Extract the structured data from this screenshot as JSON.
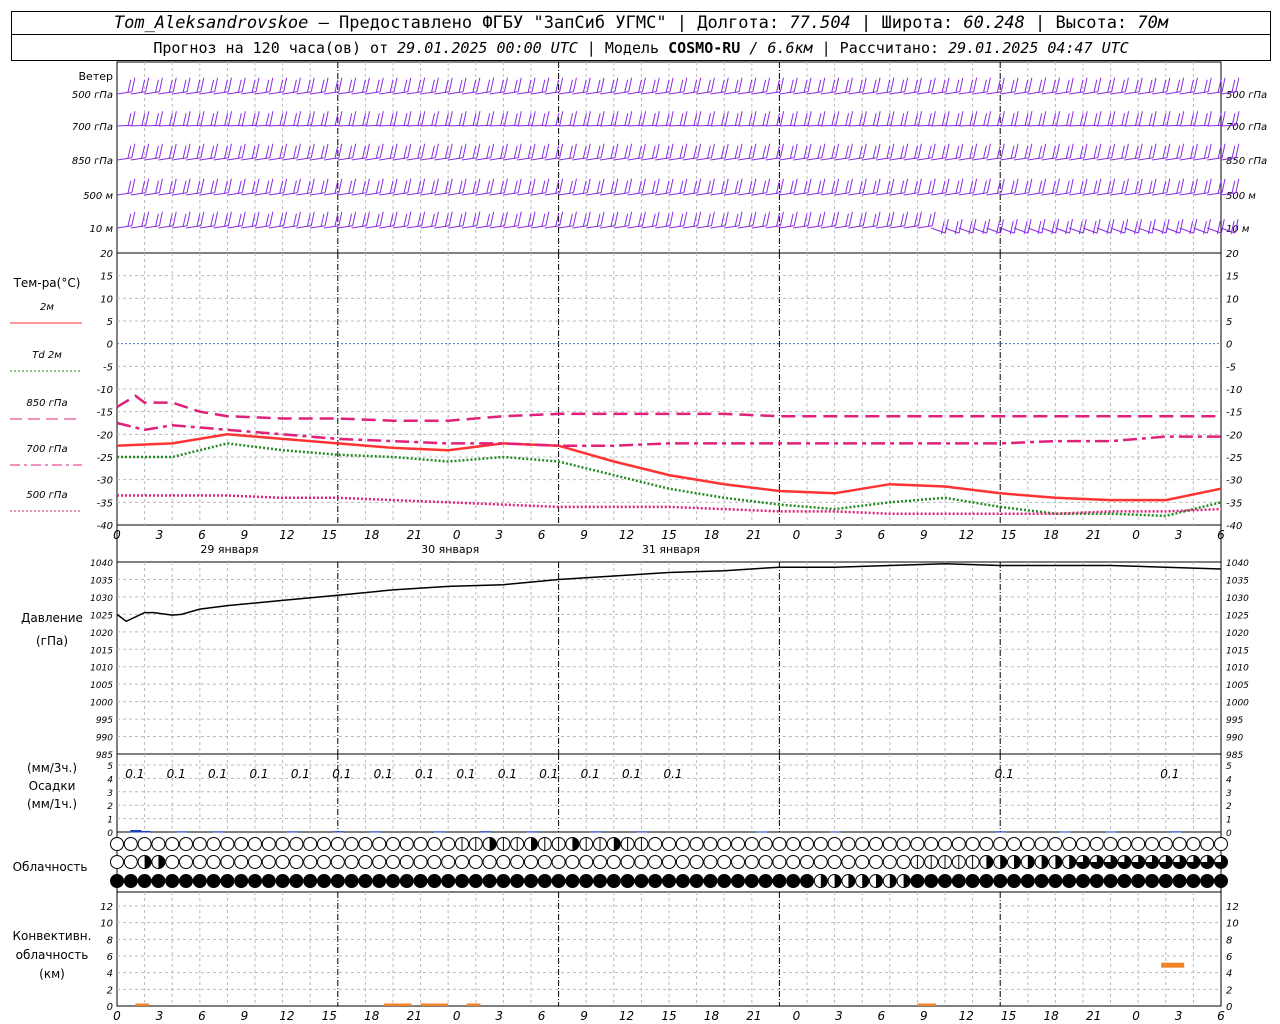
{
  "header": {
    "station": "Tom_Aleksandrovskoe",
    "provider": " — Предоставлено ФГБУ \"ЗапСиб УГМС\" | Долгота: ",
    "lon": "77.504",
    "lat_label": " | Широта: ",
    "lat": "60.248",
    "alt_label": " | Высота: ",
    "alt": "70м",
    "forecast_label": "Прогноз на 120 часа(ов) от ",
    "init_time": "29.01.2025 00:00 UTC",
    "model_label": "  | Модель ",
    "model": "COSMO-RU",
    "resolution": " / 6.6км",
    "calc_label": " | Рассчитано: ",
    "calc_time": "29.01.2025 04:47 UTC"
  },
  "chart_data": {
    "type": "meteogram",
    "hour_ticks": [
      "0",
      "3",
      "6",
      "9",
      "12",
      "15",
      "18",
      "21",
      "0",
      "3",
      "6",
      "9",
      "12",
      "15",
      "18",
      "21",
      "0",
      "3",
      "6",
      "9",
      "12",
      "15",
      "18",
      "21",
      "0",
      "3",
      "6"
    ],
    "dates": [
      "29 января",
      "30 января",
      "31 января"
    ],
    "wind": {
      "title": "Ветер",
      "levels": [
        "500 гПа",
        "700 гПа",
        "850 гПа",
        "500 м",
        "10 м"
      ],
      "color": "#8a2be2"
    },
    "temperature": {
      "title": "Тем-ра(°C)",
      "ylim": [
        -40,
        20
      ],
      "ticks": [
        20,
        15,
        10,
        5,
        0,
        -5,
        -10,
        -15,
        -20,
        -25,
        -30,
        -35,
        -40
      ],
      "legend": [
        {
          "label": "2м",
          "color": "#ff3333",
          "dash": "solid"
        },
        {
          "label": "Td  2м",
          "color": "#228b22",
          "dash": "dot"
        },
        {
          "label": "850 гПа",
          "color": "#e0207a",
          "dash": "long"
        },
        {
          "label": "700 гПа",
          "color": "#e0207a",
          "dash": "dashdot"
        },
        {
          "label": "500 гПа",
          "color": "#e0207a",
          "dash": "dot"
        }
      ],
      "series": [
        {
          "name": "2м",
          "hours": [
            0,
            6,
            12,
            18,
            24,
            30,
            36,
            42,
            48,
            54,
            60,
            66,
            72,
            78,
            84,
            90,
            96,
            102,
            108,
            114,
            120
          ],
          "values": [
            -22.5,
            -22,
            -20,
            -21,
            -22,
            -23,
            -23.5,
            -22,
            -22.5,
            -26,
            -29,
            -31,
            -32.5,
            -33,
            -31,
            -31.5,
            -33,
            -34,
            -34.5,
            -34.5,
            -32
          ]
        },
        {
          "name": "Td  2м",
          "hours": [
            0,
            6,
            12,
            18,
            24,
            30,
            36,
            42,
            48,
            54,
            60,
            66,
            72,
            78,
            84,
            90,
            96,
            102,
            108,
            114,
            120
          ],
          "values": [
            -25,
            -25,
            -22,
            -23.5,
            -24.5,
            -25,
            -26,
            -25,
            -26,
            -29,
            -32,
            -34,
            -35.5,
            -36.5,
            -35,
            -34,
            -36,
            -37.5,
            -37.5,
            -38,
            -35
          ]
        },
        {
          "name": "850 гПа",
          "hours": [
            0,
            2,
            3,
            6,
            9,
            12,
            18,
            24,
            30,
            36,
            42,
            48,
            54,
            60,
            66,
            72,
            78,
            84,
            90,
            96,
            102,
            108,
            114,
            120
          ],
          "values": [
            -14,
            -11.5,
            -13,
            -13,
            -15,
            -16,
            -16.5,
            -16.5,
            -17,
            -17,
            -16,
            -15.5,
            -15.5,
            -15.5,
            -15.5,
            -16,
            -16,
            -16,
            -16,
            -16,
            -16,
            -16,
            -16,
            -16
          ]
        },
        {
          "name": "700 гПа",
          "hours": [
            0,
            3,
            6,
            12,
            18,
            24,
            30,
            36,
            42,
            48,
            54,
            60,
            66,
            72,
            78,
            84,
            90,
            96,
            102,
            108,
            114,
            120
          ],
          "values": [
            -17.5,
            -19,
            -18,
            -19,
            -20,
            -21,
            -21.5,
            -22,
            -22,
            -22.5,
            -22.5,
            -22,
            -22,
            -22,
            -22,
            -22,
            -22,
            -22,
            -21.5,
            -21.5,
            -20.5,
            -20.5
          ]
        },
        {
          "name": "500 гПа",
          "hours": [
            0,
            6,
            12,
            18,
            24,
            30,
            36,
            42,
            48,
            54,
            60,
            66,
            72,
            78,
            84,
            90,
            96,
            102,
            108,
            114,
            120
          ],
          "values": [
            -33.5,
            -33.5,
            -33.5,
            -34,
            -34,
            -34.5,
            -35,
            -35.5,
            -36,
            -36,
            -36,
            -36.5,
            -37,
            -37,
            -37.5,
            -37.5,
            -37.5,
            -37.5,
            -37,
            -37,
            -36.5
          ]
        }
      ]
    },
    "pressure": {
      "title": "Давление",
      "unit": "(гПа)",
      "ylim": [
        985,
        1040
      ],
      "ticks": [
        1040,
        1035,
        1030,
        1025,
        1020,
        1015,
        1010,
        1005,
        1000,
        995,
        990,
        985
      ],
      "hours": [
        0,
        1,
        3,
        4,
        6,
        7,
        9,
        12,
        18,
        24,
        30,
        36,
        42,
        48,
        54,
        60,
        66,
        72,
        78,
        84,
        90,
        96,
        102,
        108,
        114,
        120
      ],
      "values": [
        1025,
        1023,
        1025.5,
        1025.5,
        1024.8,
        1025,
        1026.5,
        1027.5,
        1029,
        1030.5,
        1032,
        1033,
        1033.5,
        1035,
        1036,
        1037,
        1037.5,
        1038.5,
        1038.5,
        1039,
        1039.5,
        1039,
        1039,
        1039,
        1038.5,
        1038
      ]
    },
    "precip": {
      "title1": "(мм/3ч.)",
      "title2": "Осадки",
      "title3": "(мм/1ч.)",
      "ylim": [
        0,
        5
      ],
      "ticks": [
        5,
        4,
        3,
        2,
        1,
        0
      ],
      "labels_3h": [
        {
          "hour": 1.5,
          "value": "0.1"
        },
        {
          "hour": 6,
          "value": "0.1"
        },
        {
          "hour": 10.5,
          "value": "0.1"
        },
        {
          "hour": 15,
          "value": "0.1"
        },
        {
          "hour": 19.5,
          "value": "0.1"
        },
        {
          "hour": 24,
          "value": "0.1"
        },
        {
          "hour": 28.5,
          "value": "0.1"
        },
        {
          "hour": 33,
          "value": "0.1"
        },
        {
          "hour": 37.5,
          "value": "0.1"
        },
        {
          "hour": 42,
          "value": "0.1"
        },
        {
          "hour": 46.5,
          "value": "0.1"
        },
        {
          "hour": 51,
          "value": "0.1"
        },
        {
          "hour": 55.5,
          "value": "0.1"
        },
        {
          "hour": 60,
          "value": "0.1"
        },
        {
          "hour": 96,
          "value": "0.1"
        },
        {
          "hour": 114,
          "value": "0.1"
        }
      ],
      "bars_1h": [
        [
          2,
          0.15
        ],
        [
          3,
          0.08
        ],
        [
          7,
          0.05
        ],
        [
          11,
          0.05
        ],
        [
          19,
          0.05
        ],
        [
          24,
          0.06
        ],
        [
          28,
          0.05
        ],
        [
          35,
          0.05
        ],
        [
          40,
          0.06
        ],
        [
          45,
          0.05
        ],
        [
          52,
          0.05
        ],
        [
          57,
          0.05
        ],
        [
          70,
          0.04
        ],
        [
          78,
          0.04
        ],
        [
          96,
          0.05
        ],
        [
          103,
          0.04
        ],
        [
          108,
          0.04
        ],
        [
          115,
          0.05
        ]
      ]
    },
    "cloudiness": {
      "title": "Облачность",
      "rows": [
        {
          "name": "high",
          "cover": [
            0,
            0,
            0,
            0,
            0,
            0,
            0,
            0,
            0,
            0,
            0,
            0,
            0,
            0,
            0,
            0,
            0,
            0,
            0,
            0,
            0,
            0,
            0,
            0,
            0,
            0,
            0,
            0,
            0,
            0,
            0,
            0,
            0,
            0,
            0,
            0,
            0,
            0,
            0,
            0,
            0,
            0,
            0,
            0,
            0,
            0,
            0,
            0,
            0,
            0,
            0,
            0,
            0,
            0,
            0,
            0,
            0,
            0,
            0,
            0,
            0,
            0,
            0,
            0,
            0,
            0,
            0,
            0,
            0,
            0,
            0,
            0,
            0,
            0,
            0,
            0,
            0,
            0,
            0,
            0,
            0,
            0,
            0,
            0,
            0,
            0,
            0,
            0,
            0,
            0,
            0,
            0,
            0,
            0,
            0,
            0,
            0,
            0,
            0,
            0,
            0,
            0,
            0,
            0,
            0,
            0,
            0,
            0,
            0,
            0,
            0,
            0,
            0,
            0,
            0,
            0,
            0,
            0,
            0,
            0,
            0
          ]
        },
        {
          "name": "mid",
          "cover": []
        },
        {
          "name": "low",
          "cover": []
        }
      ]
    },
    "convective": {
      "title1": "Конвективн.",
      "title2": "облачность",
      "title3": "(км)",
      "ylim": [
        0,
        13
      ],
      "ticks": [
        12,
        10,
        8,
        6,
        4,
        2,
        0
      ],
      "bars": [
        {
          "h0": 2,
          "h1": 3.5,
          "base": 0,
          "top": 0.3
        },
        {
          "h0": 29,
          "h1": 32,
          "base": 0,
          "top": 0.3
        },
        {
          "h0": 33,
          "h1": 36,
          "base": 0,
          "top": 0.3
        },
        {
          "h0": 38,
          "h1": 39.5,
          "base": 0,
          "top": 0.3
        },
        {
          "h0": 87,
          "h1": 89,
          "base": 0,
          "top": 0.3
        },
        {
          "h0": 113.5,
          "h1": 116,
          "base": 4.6,
          "top": 5.2
        }
      ],
      "color": "#f0822a"
    }
  }
}
